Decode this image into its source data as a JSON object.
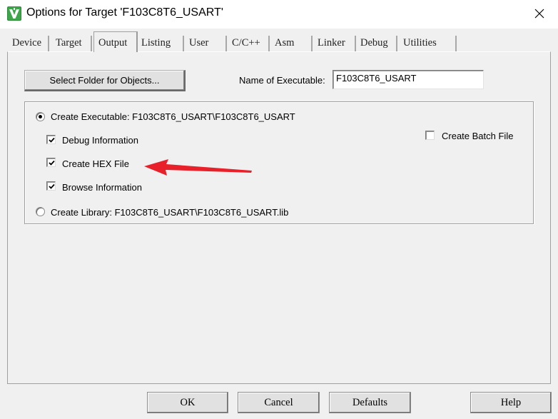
{
  "window": {
    "title": "Options for Target 'F103C8T6_USART'",
    "app_icon": "keil-uvision-icon",
    "close_icon": "close-icon"
  },
  "tabs": [
    {
      "label": "Device",
      "active": false
    },
    {
      "label": "Target",
      "active": false
    },
    {
      "label": "Output",
      "active": true
    },
    {
      "label": "Listing",
      "active": false
    },
    {
      "label": "User",
      "active": false
    },
    {
      "label": "C/C++",
      "active": false
    },
    {
      "label": "Asm",
      "active": false
    },
    {
      "label": "Linker",
      "active": false
    },
    {
      "label": "Debug",
      "active": false
    },
    {
      "label": "Utilities",
      "active": false
    }
  ],
  "output": {
    "select_folder_label": "Select Folder for Objects...",
    "name_of_executable_label": "Name of Executable:",
    "name_of_executable_value": "F103C8T6_USART",
    "create_executable": {
      "label": "Create Executable:  F103C8T6_USART\\F103C8T6_USART",
      "selected": true
    },
    "debug_information": {
      "label": "Debug Information",
      "checked": true
    },
    "create_hex_file": {
      "label": "Create HEX File",
      "checked": true
    },
    "browse_information": {
      "label": "Browse Information",
      "checked": true
    },
    "create_batch_file": {
      "label": "Create Batch File",
      "checked": false
    },
    "create_library": {
      "label": "Create Library:  F103C8T6_USART\\F103C8T6_USART.lib",
      "selected": false
    },
    "annotation_arrow_color": "#e8202a"
  },
  "buttons": {
    "ok": "OK",
    "cancel": "Cancel",
    "defaults": "Defaults",
    "help": "Help"
  }
}
